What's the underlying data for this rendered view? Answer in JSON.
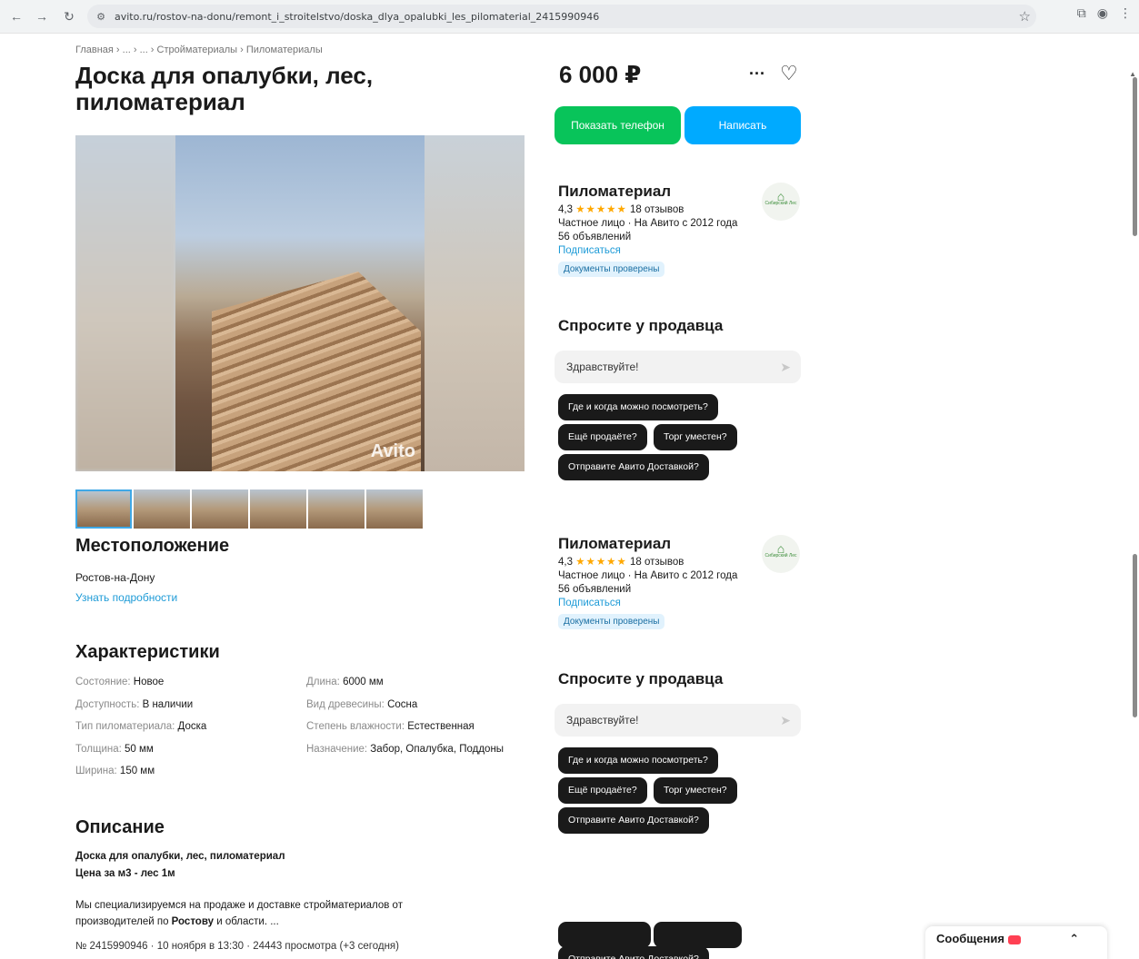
{
  "browser": {
    "url": "avito.ru/rostov-na-donu/remont_i_stroitelstvo/doska_dlya_opalubki_les_pilomaterial_2415990946"
  },
  "page": {
    "breadcrumb": "Главная › ... › ... › Стройматериалы › Пиломатериалы",
    "title": "Доска для опалубки, лес, пиломатериал",
    "photo_watermark": "Avito",
    "location": {
      "title": "Местоположение",
      "city": "Ростов-на-Дону",
      "details_link": "Узнать подробности"
    },
    "specs": {
      "title": "Характеристики",
      "left": [
        {
          "k": "Состояние: ",
          "v": "Новое"
        },
        {
          "k": "Доступность: ",
          "v": "В наличии"
        },
        {
          "k": "Тип пиломатериала: ",
          "v": "Доска"
        },
        {
          "k": "Толщина: ",
          "v": "50 мм"
        },
        {
          "k": "Ширина: ",
          "v": "150 мм"
        }
      ],
      "right": [
        {
          "k": "Длина: ",
          "v": "6000 мм"
        },
        {
          "k": "Вид древесины: ",
          "v": "Сосна"
        },
        {
          "k": "Степень влажности: ",
          "v": "Естественная"
        },
        {
          "k": "Назначение: ",
          "v": "Забор, Опалубка, Поддоны"
        }
      ]
    },
    "description": {
      "title": "Описание",
      "bold_line_1": "Доска для опалубки, лес, пиломатериал",
      "bold_line_2": "Цена за м3 - лес 1м",
      "text_1": "Мы специализируемся на продаже и доставке стройматериалов от",
      "text_2_start": "производителей по ",
      "text_2_bold": "Ростову",
      "text_2_end": " и области. ...",
      "meta": "№ 2415990946 · 10 ноября в 13:30 · 24443 просмотра (+3 сегодня)"
    }
  },
  "sidebar": {
    "price": "6 000 ₽",
    "phone_button": "Показать телефон",
    "write_button": "Написать",
    "seller": {
      "name": "Пиломатериал",
      "rating": "4,3",
      "stars": "★★★★★",
      "reviews": "18 отзывов",
      "type": "Частное лицо · На Авито с 2012 года",
      "ads": "56 объявлений",
      "subscribe": "Подписаться",
      "badge": "Документы проверены",
      "logo_caption": "Сибирский Лес"
    },
    "ask": {
      "title": "Спросите у продавца",
      "input_value": "Здравствуйте!",
      "chips": [
        "Где и когда можно посмотреть?",
        "Ещё продаёте?",
        "Торг уместен?",
        "Отправите Авито Доставкой?"
      ]
    },
    "messages_tab": "Сообщения"
  },
  "colors": {
    "green": "#08c45a",
    "blue": "#00aaff",
    "link": "#1e9bd7",
    "star": "#ffa800"
  }
}
